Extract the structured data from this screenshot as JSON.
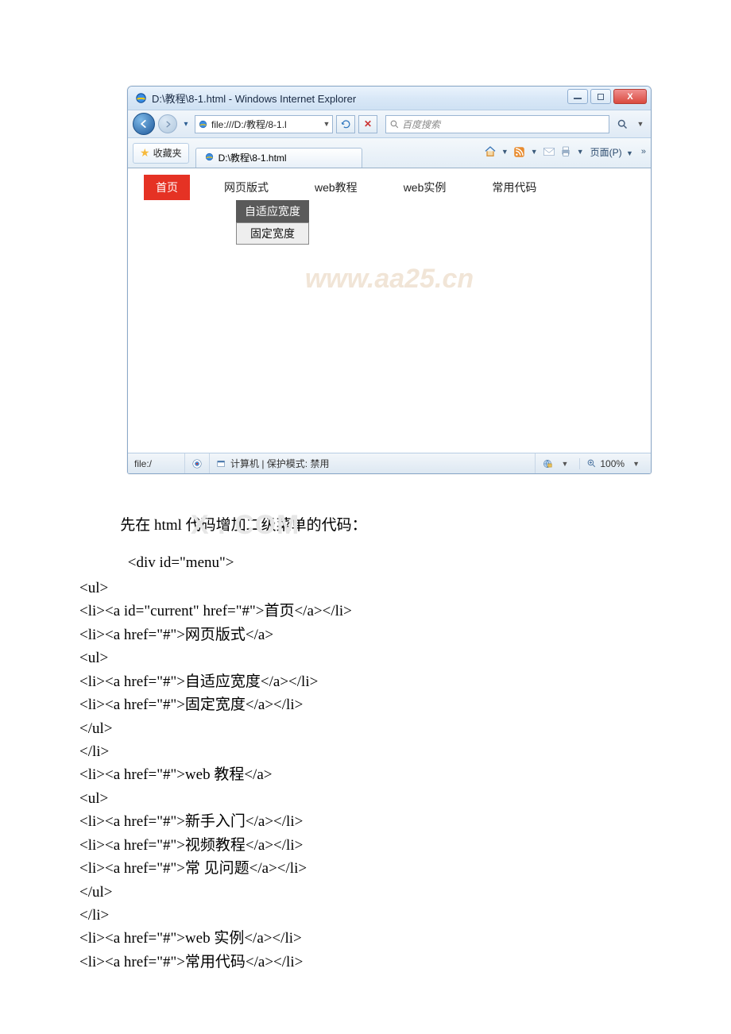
{
  "window": {
    "title": "D:\\教程\\8-1.html - Windows Internet Explorer",
    "address": "file:///D:/教程/8-1.l",
    "search_placeholder": "百度搜索",
    "favorites_label": "收藏夹",
    "tab_label": "D:\\教程\\8-1.html",
    "cmd_page": "页面(P)",
    "cmd_more": "»"
  },
  "menu": {
    "items": [
      "首页",
      "网页版式",
      "web教程",
      "web实例",
      "常用代码"
    ],
    "sub": [
      "自适应宽度",
      "固定宽度"
    ]
  },
  "watermark1": "www.aa25.cn",
  "statusbar": {
    "left": "file:/",
    "mid": "计算机 | 保护模式: 禁用",
    "zoom": "100%"
  },
  "article": {
    "intro": "先在 html 代码增加二级菜单的代码：",
    "wm2": "X . COM",
    "divline": "<div id=\"menu\">",
    "code": [
      "<ul>",
      "<li><a id=\"current\" href=\"#\">首页</a></li>",
      "<li><a href=\"#\">网页版式</a>",
      "<ul>",
      "<li><a href=\"#\">自适应宽度</a></li>",
      "<li><a href=\"#\">固定宽度</a></li>",
      "</ul>",
      "</li>",
      "<li><a href=\"#\">web 教程</a>",
      "<ul>",
      "<li><a href=\"#\">新手入门</a></li>",
      "<li><a href=\"#\">视频教程</a></li>",
      "<li><a href=\"#\">常 见问题</a></li>",
      "</ul>",
      "</li>",
      "<li><a href=\"#\">web 实例</a></li>",
      "<li><a href=\"#\">常用代码</a></li>"
    ]
  }
}
